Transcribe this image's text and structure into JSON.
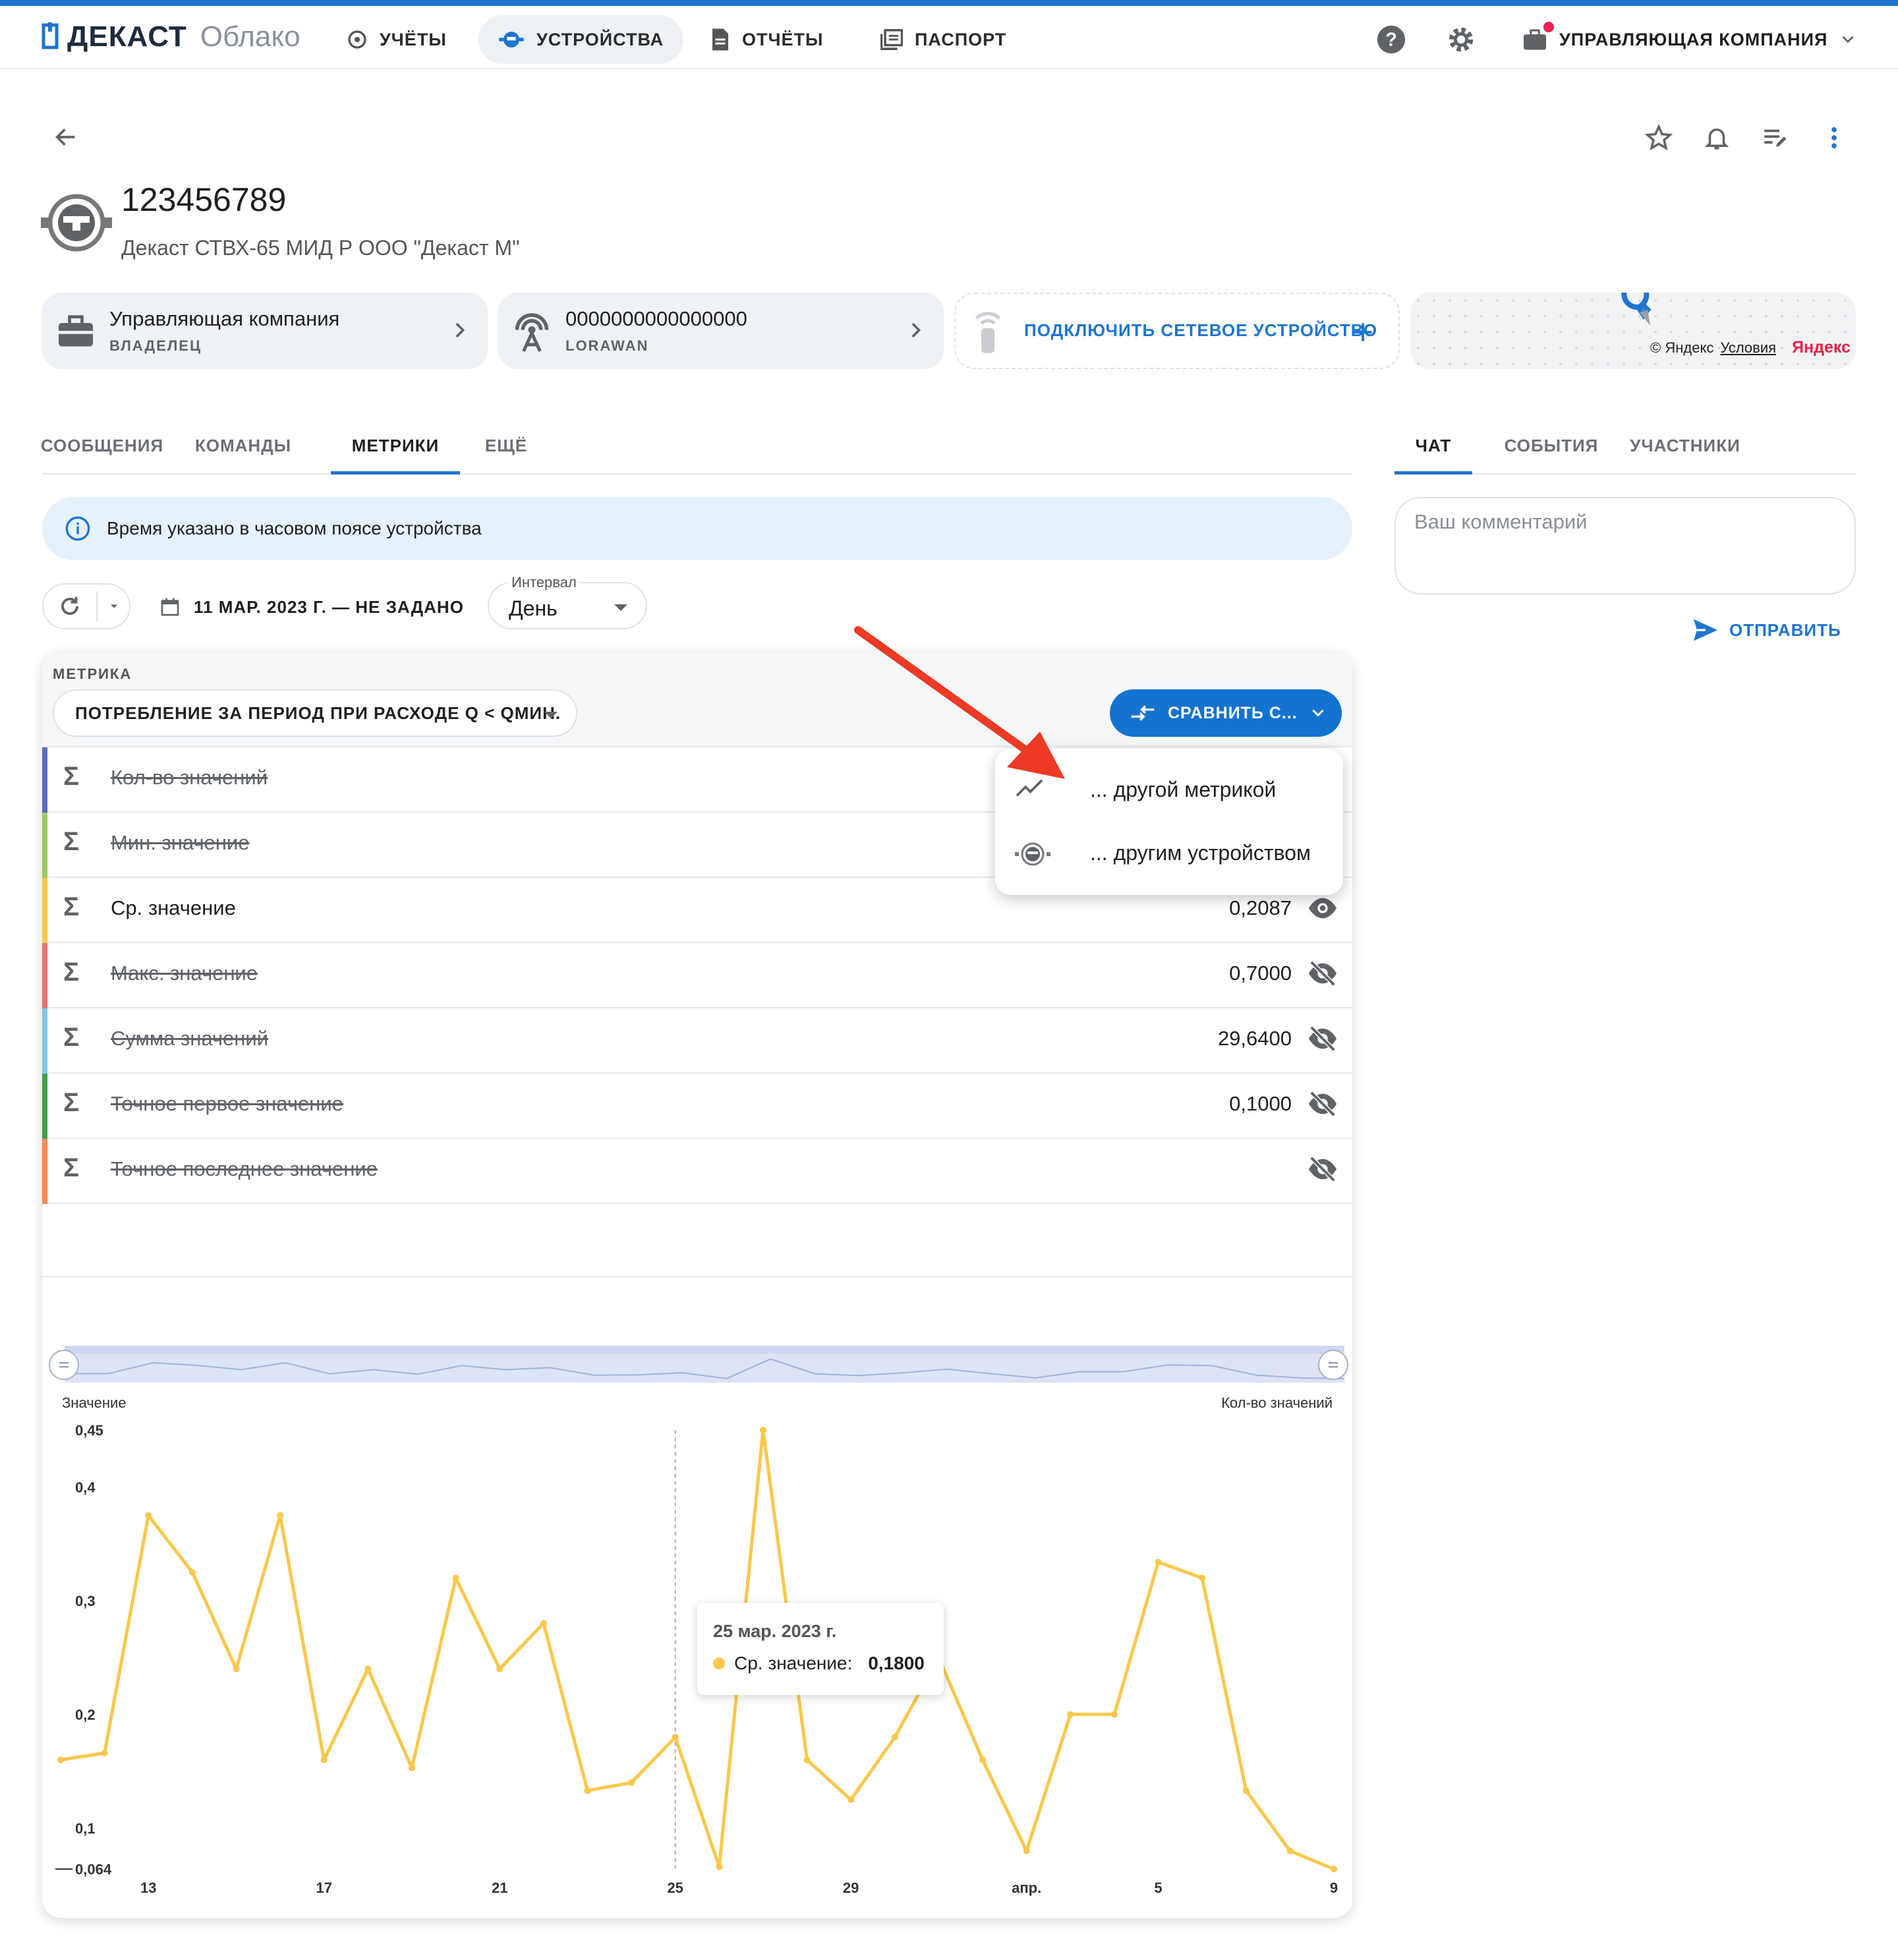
{
  "brand": {
    "name": "ДЕКАСТ",
    "sub": "Облако"
  },
  "nav": {
    "items": [
      {
        "label": "УЧЁТЫ",
        "active": false
      },
      {
        "label": "УСТРОЙСТВА",
        "active": true
      },
      {
        "label": "ОТЧЁТЫ",
        "active": false
      },
      {
        "label": "ПАСПОРТ",
        "active": false
      }
    ],
    "company": "УПРАВЛЯЮЩАЯ КОМПАНИЯ"
  },
  "device": {
    "title": "123456789",
    "subtitle": "Декаст СТВХ-65 МИД Р ООО \"Декаст М\""
  },
  "cards": {
    "owner": {
      "title": "Управляющая компания",
      "sub": "ВЛАДЕЛЕЦ"
    },
    "network": {
      "title": "0000000000000000",
      "sub": "LORAWAN"
    },
    "connect": {
      "label": "ПОДКЛЮЧИТЬ СЕТЕВОЕ УСТРОЙСТВО"
    },
    "map": {
      "copyright": "© Яндекс",
      "terms": "Условия",
      "brand": "Яндекс"
    }
  },
  "tabs": {
    "items": [
      {
        "label": "СООБЩЕНИЯ"
      },
      {
        "label": "КОМАНДЫ"
      },
      {
        "label": "МЕТРИКИ",
        "active": true
      },
      {
        "label": "ЕЩЁ"
      }
    ]
  },
  "right_tabs": {
    "items": [
      {
        "label": "ЧАТ",
        "active": true
      },
      {
        "label": "СОБЫТИЯ"
      },
      {
        "label": "УЧАСТНИКИ"
      }
    ]
  },
  "info": {
    "text": "Время указано в часовом поясе устройства"
  },
  "filters": {
    "daterange": "11 МАР. 2023 Г. — НЕ ЗАДАНО",
    "interval_label": "Интервал",
    "interval_value": "День"
  },
  "metric": {
    "label": "МЕТРИКА",
    "selected": "ПОТРЕБЛЕНИЕ ЗА ПЕРИОД ПРИ РАСХОДЕ Q < QМИН.",
    "compare": "СРАВНИТЬ С..."
  },
  "compare_menu": [
    {
      "label": "... другой метрикой",
      "icon": "trend-icon"
    },
    {
      "label": "... другим устройством",
      "icon": "device-icon"
    }
  ],
  "stats": [
    {
      "name": "Кол-во значений",
      "value": "",
      "visible": false,
      "color": "#5c6bc0"
    },
    {
      "name": "Мин. значение",
      "value": "",
      "visible": false,
      "color": "#9ccc65"
    },
    {
      "name": "Ср. значение",
      "value": "0,2087",
      "visible": true,
      "color": "#f9c84b"
    },
    {
      "name": "Макс. значение",
      "value": "0,7000",
      "visible": false,
      "color": "#e57373"
    },
    {
      "name": "Сумма значений",
      "value": "29,6400",
      "visible": false,
      "color": "#81c7e8"
    },
    {
      "name": "Точное первое значение",
      "value": "0,1000",
      "visible": false,
      "color": "#43a047"
    },
    {
      "name": "Точное последнее значение",
      "value": "",
      "visible": false,
      "color": "#ff8a50"
    }
  ],
  "comment": {
    "placeholder": "Ваш комментарий",
    "send": "ОТПРАВИТЬ"
  },
  "chart_data": {
    "type": "line",
    "ylabel": "Значение",
    "y2label": "Кол-во значений",
    "ylim": [
      0.064,
      0.45
    ],
    "yticks": [
      "0,45",
      "0,4",
      "0,3",
      "0,2",
      "0,1",
      "0,064"
    ],
    "ytick_values": [
      0.45,
      0.4,
      0.3,
      0.2,
      0.1,
      0.064
    ],
    "xticks": [
      "13",
      "17",
      "21",
      "25",
      "29",
      "апр.",
      "5",
      "9"
    ],
    "xtick_values": [
      "2023-03-13",
      "2023-03-17",
      "2023-03-21",
      "2023-03-25",
      "2023-03-29",
      "2023-04-02",
      "2023-04-05",
      "2023-04-09"
    ],
    "series": [
      {
        "name": "Ср. значение",
        "color": "#f9c84b",
        "x": [
          "2023-03-11",
          "2023-03-12",
          "2023-03-13",
          "2023-03-14",
          "2023-03-15",
          "2023-03-16",
          "2023-03-17",
          "2023-03-18",
          "2023-03-19",
          "2023-03-20",
          "2023-03-21",
          "2023-03-22",
          "2023-03-23",
          "2023-03-24",
          "2023-03-25",
          "2023-03-26",
          "2023-03-27",
          "2023-03-28",
          "2023-03-29",
          "2023-03-30",
          "2023-03-31",
          "2023-04-01",
          "2023-04-02",
          "2023-04-03",
          "2023-04-04",
          "2023-04-05",
          "2023-04-06",
          "2023-04-07",
          "2023-04-08",
          "2023-04-09"
        ],
        "values": [
          0.16,
          0.166,
          0.375,
          0.325,
          0.24,
          0.375,
          0.16,
          0.24,
          0.153,
          0.32,
          0.24,
          0.28,
          0.133,
          0.14,
          0.18,
          0.066,
          0.45,
          0.16,
          0.125,
          0.18,
          0.25,
          0.16,
          0.08,
          0.2,
          0.2,
          0.334,
          0.32,
          0.133,
          0.08,
          0.064
        ]
      }
    ],
    "tooltip": {
      "date": "25 мар. 2023 г.",
      "series": "Ср. значение:",
      "value": "0,1800"
    }
  }
}
